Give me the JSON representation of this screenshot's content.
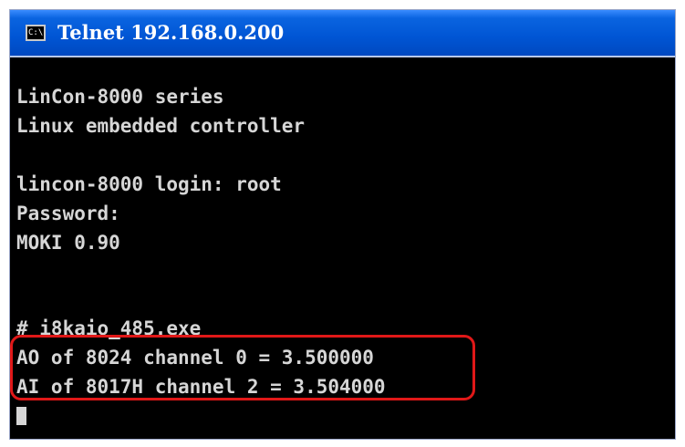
{
  "window": {
    "title": "Telnet 192.168.0.200",
    "icon_label": "C:\\",
    "icon": "console-icon"
  },
  "terminal": {
    "lines": [
      "LinCon-8000 series",
      "Linux embedded controller",
      "",
      "lincon-8000 login: root",
      "Password:",
      "MOKI 0.90",
      "",
      "",
      "# i8kaio_485.exe",
      "AO of 8024 channel 0 = 3.500000",
      "AI of 8017H channel 2 = 3.504000",
      "#"
    ]
  },
  "colors": {
    "titlebar": "#0055d4",
    "terminal_bg": "#000000",
    "terminal_text": "#d6d6d6",
    "highlight": "#e01818"
  }
}
